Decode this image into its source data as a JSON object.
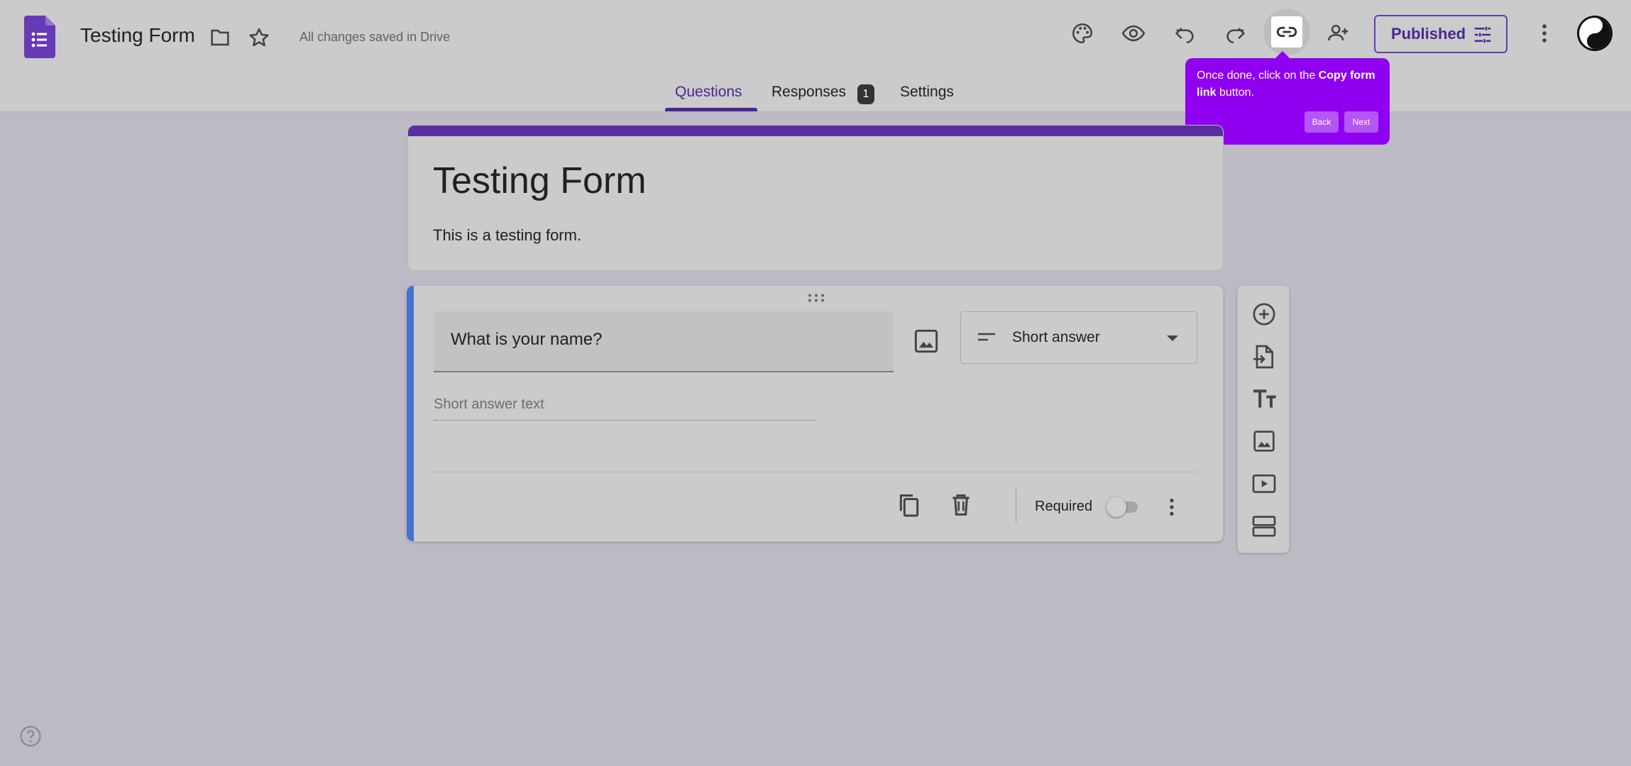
{
  "header": {
    "title": "Testing Form",
    "saved_status": "All changes saved in Drive",
    "published_label": "Published",
    "icons": [
      "forms-logo-icon",
      "folder-icon",
      "star-icon",
      "palette-icon",
      "preview-eye-icon",
      "undo-icon",
      "redo-icon",
      "link-icon",
      "add-collaborator-icon",
      "tune-icon",
      "more-vert-icon",
      "avatar"
    ]
  },
  "tabs": [
    {
      "label": "Questions",
      "active": true
    },
    {
      "label": "Responses",
      "badge": "1"
    },
    {
      "label": "Settings"
    }
  ],
  "tooltip": {
    "text_before": "Once done, click on the ",
    "text_bold": "Copy form link",
    "text_after": " button.",
    "back_label": "Back",
    "next_label": "Next"
  },
  "form": {
    "title": "Testing Form",
    "description": "This is a testing form."
  },
  "question": {
    "text": "What is your name?",
    "type": "Short answer",
    "answer_placeholder": "Short answer text",
    "required_label": "Required",
    "required": false
  },
  "side_toolbar": [
    "add-question-icon",
    "import-questions-icon",
    "add-title-icon",
    "add-image-icon",
    "add-video-icon",
    "add-section-icon"
  ],
  "colors": {
    "accent": "#4b2791",
    "tooltip": "#9000f0",
    "question_bar": "#4470d0",
    "background": "#bdb9c5"
  }
}
